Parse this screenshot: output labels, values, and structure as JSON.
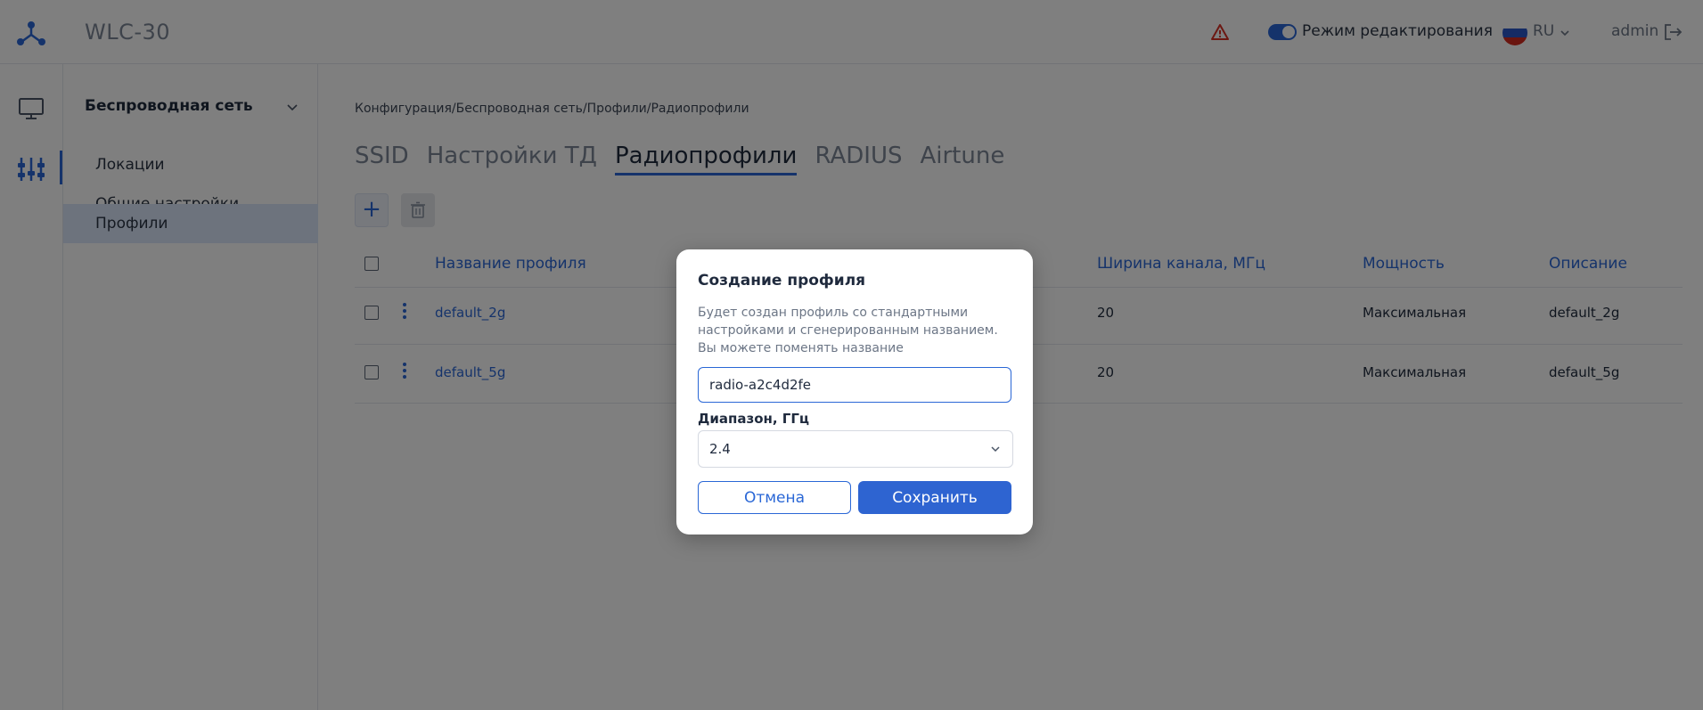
{
  "header": {
    "app_title": "WLC-30",
    "edit_mode_label": "Режим редактирования",
    "language": "RU",
    "user": "admin"
  },
  "sidebar": {
    "group_label": "Беспроводная сеть",
    "items": [
      {
        "label": "Локации"
      },
      {
        "label": "Общие настройки"
      },
      {
        "label": "Профили"
      }
    ]
  },
  "main": {
    "breadcrumb": "Конфигурация/Беспроводная сеть/Профили/Радиопрофили",
    "tabs": [
      {
        "label": "SSID"
      },
      {
        "label": "Настройки ТД"
      },
      {
        "label": "Радиопрофили"
      },
      {
        "label": "RADIUS"
      },
      {
        "label": "Airtune"
      }
    ],
    "add_label": "+",
    "table": {
      "headers": [
        "Название профиля",
        "Ширина канала, МГц",
        "Мощность",
        "Описание"
      ],
      "rows": [
        [
          "default_2g",
          "20",
          "Максимальная",
          "default_2g"
        ],
        [
          "default_5g",
          "20",
          "Максимальная",
          "default_5g"
        ]
      ]
    }
  },
  "modal": {
    "title": "Создание профиля",
    "description": "Будет создан профиль со стандартными настройками и сгенерированным названием. Вы можете поменять название",
    "name_value": "radio-a2c4d2fe",
    "range_label": "Диапазон, ГГц",
    "range_value": "2.4",
    "cancel_label": "Отмена",
    "save_label": "Сохранить"
  },
  "colors": {
    "accent": "#2a67d6",
    "warning": "#d93025"
  }
}
